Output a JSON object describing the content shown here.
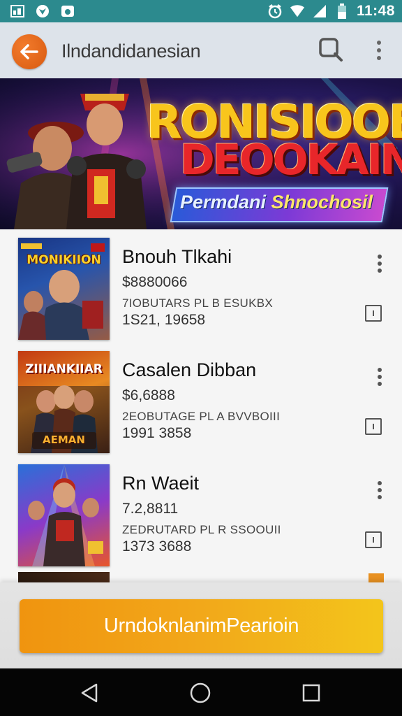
{
  "status_bar": {
    "time": "11:48",
    "left_icons": [
      "gallery-icon",
      "location-icon",
      "cloud-icon"
    ],
    "right_icons": [
      "alarm-icon",
      "wifi-icon",
      "signal-icon",
      "battery-icon"
    ]
  },
  "app_bar": {
    "title": "Ilndandidanesian",
    "back_icon": "arrow-left-icon",
    "search_icon": "search-icon",
    "more_icon": "more-vertical-icon"
  },
  "banner": {
    "title_line1": "RONISIOOE",
    "title_line2": "DEOOKAIN",
    "subtitle_main": "Permdani ",
    "subtitle_accent": "Shnochosil"
  },
  "list": {
    "items": [
      {
        "thumb_title": "MONIKIION",
        "name": "Bnouh Tlkahi",
        "price": "$8880066",
        "desc": "7IOBUTARS PL B ESUKBX",
        "date": "1S21, 19658"
      },
      {
        "thumb_title": "ZIIIANKIIAR",
        "thumb_subtitle": "AEMAN",
        "name": "Casalen Dibban",
        "price": "$6,6888",
        "desc": "2EOBUTAGE PL A BVVBOIII",
        "date": "1991 3858"
      },
      {
        "thumb_title": "",
        "name": "Rn Waeit",
        "price": "7.2,8811",
        "desc": "ZEDRUTARD PL R SSOOUII",
        "date": "1373 3688"
      }
    ]
  },
  "cta": {
    "label": "UrndoknlanimPearioin"
  },
  "nav": {
    "icons": [
      "back-triangle-icon",
      "home-circle-icon",
      "recents-square-icon"
    ]
  }
}
